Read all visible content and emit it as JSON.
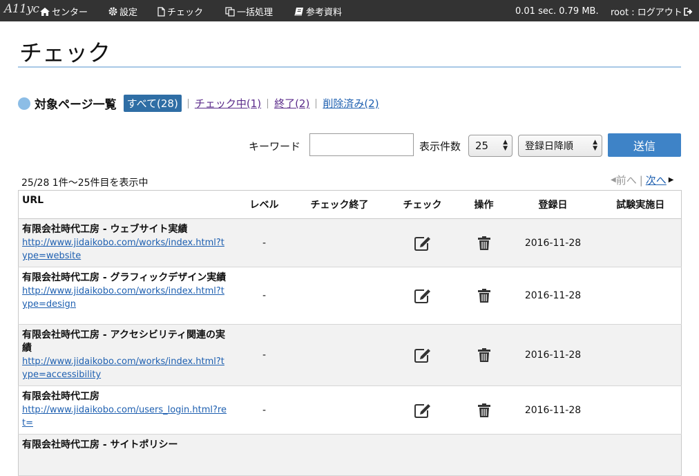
{
  "topbar": {
    "logo": "A11yc",
    "nav": [
      {
        "icon": "home-icon",
        "label": "センター"
      },
      {
        "icon": "gear-icon",
        "label": "設定"
      },
      {
        "icon": "file-icon",
        "label": "チェック"
      },
      {
        "icon": "copy-icon",
        "label": "一括処理"
      },
      {
        "icon": "book-icon",
        "label": "参考資料"
      }
    ],
    "perf": "0.01 sec. 0.79 MB.",
    "logout": "root : ログアウト"
  },
  "page": {
    "title": "チェック"
  },
  "section": {
    "title": "対象ページ一覧",
    "filters": {
      "all": "すべて(28)",
      "checking": "チェック中(1)",
      "done": "終了(2)",
      "deleted": "削除済み(2)"
    }
  },
  "search": {
    "keyword_label": "キーワード",
    "keyword_value": "",
    "count_label": "表示件数",
    "count_value": "25",
    "order_value": "登録日降順",
    "submit_label": "送信"
  },
  "results": {
    "info": "25/28 1件〜25件目を表示中",
    "prev": "前へ",
    "next": "次へ"
  },
  "table": {
    "headers": [
      "URL",
      "レベル",
      "チェック終了",
      "チェック",
      "操作",
      "登録日",
      "試験実施日"
    ],
    "rows": [
      {
        "title": "有限会社時代工房 - ウェブサイト実績",
        "url": "http://www.jidaikobo.com/works/index.html?type=website",
        "level": "-",
        "finished": "",
        "date": "2016-11-28",
        "test_date": ""
      },
      {
        "title": "有限会社時代工房 - グラフィックデザイン実績",
        "url": "http://www.jidaikobo.com/works/index.html?type=design",
        "level": "-",
        "finished": "",
        "date": "2016-11-28",
        "test_date": ""
      },
      {
        "title": "有限会社時代工房 - アクセシビリティ関連の実績",
        "url": "http://www.jidaikobo.com/works/index.html?type=accessibility",
        "level": "-",
        "finished": "",
        "date": "2016-11-28",
        "test_date": ""
      },
      {
        "title": "有限会社時代工房",
        "url": "http://www.jidaikobo.com/users_login.html?ret=",
        "level": "-",
        "finished": "",
        "date": "2016-11-28",
        "test_date": ""
      },
      {
        "title": "有限会社時代工房 - サイトポリシー",
        "url": "",
        "level": "",
        "finished": "",
        "date": "",
        "test_date": ""
      }
    ]
  }
}
